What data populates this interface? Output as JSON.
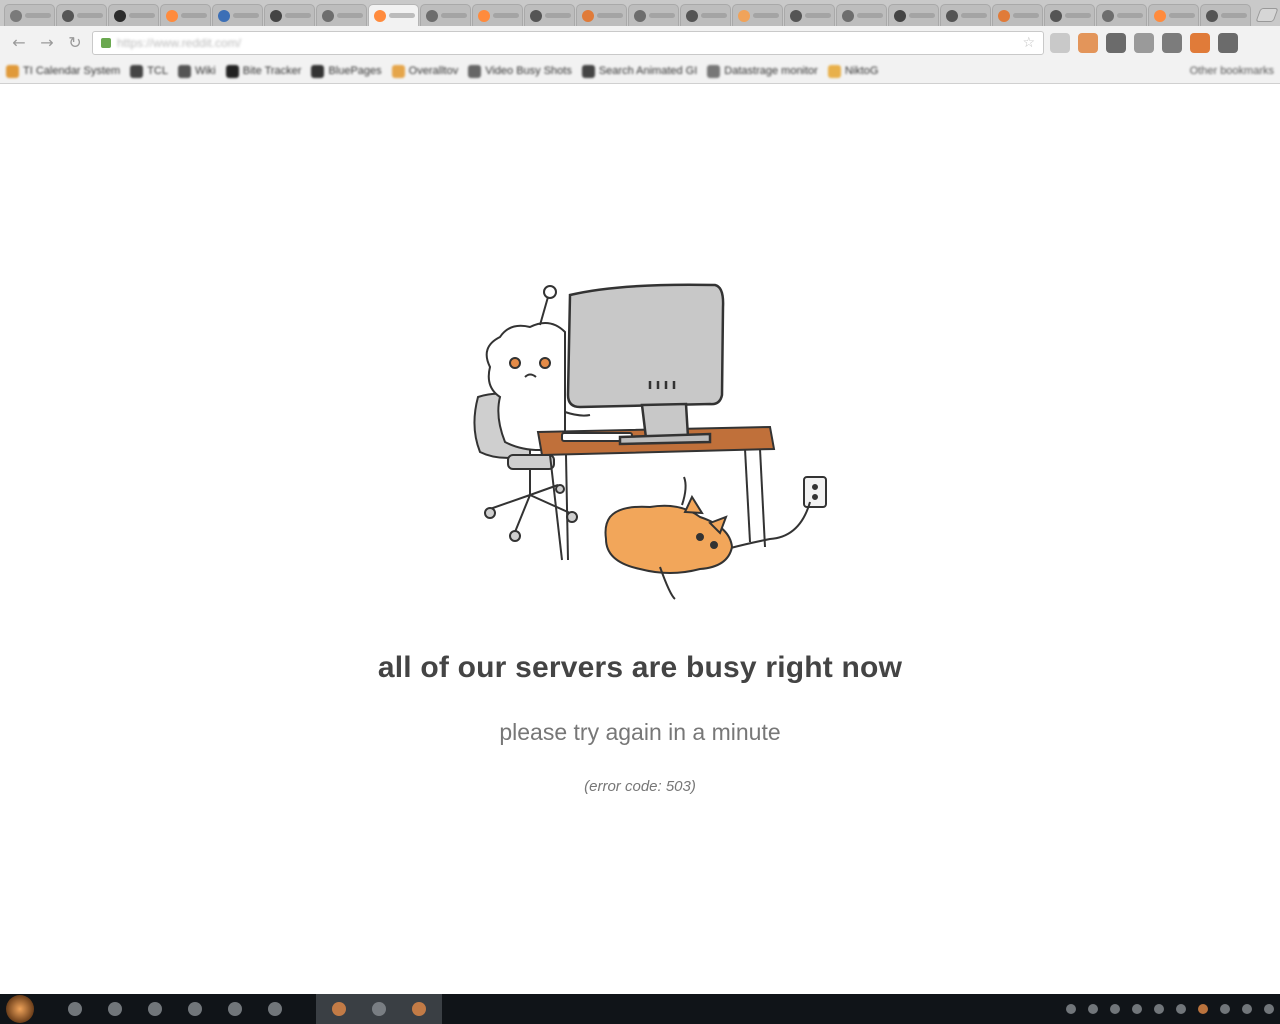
{
  "browser": {
    "tab_favicon_colors": [
      "#7a7a7a",
      "#555555",
      "#2b2b2b",
      "#ff8b3d",
      "#3c6fb6",
      "#444444",
      "#6d6d6d",
      "#ff8b3d",
      "#6d6d6d",
      "#ff8b3d",
      "#555555",
      "#e07b39",
      "#6d6d6d",
      "#555555",
      "#f0a35a",
      "#555555",
      "#6d6d6d",
      "#444444",
      "#555555",
      "#e07b39",
      "#555555",
      "#6d6d6d",
      "#ff8b3d",
      "#555555"
    ],
    "active_tab_index": 7,
    "url": "https://www.reddit.com/",
    "extension_colors": [
      "#c9c9c9",
      "#e3955a",
      "#6b6b6b",
      "#9a9a9a",
      "#7c7c7c",
      "#e07b39",
      "#6b6b6b"
    ]
  },
  "bookmarks": {
    "items": [
      {
        "label": "TI Calendar System",
        "color": "#e09a3a"
      },
      {
        "label": "TCL",
        "color": "#444444"
      },
      {
        "label": "Wiki",
        "color": "#555555"
      },
      {
        "label": "Bite Tracker",
        "color": "#222222"
      },
      {
        "label": "BluePages",
        "color": "#333333"
      },
      {
        "label": "Overalltov",
        "color": "#e5a54a"
      },
      {
        "label": "Video Busy Shots",
        "color": "#666666"
      },
      {
        "label": "Search Animated GI",
        "color": "#444444"
      },
      {
        "label": "Datastrage monitor",
        "color": "#777777"
      },
      {
        "label": "NiktoG",
        "color": "#e8b04a"
      }
    ],
    "other_label": "Other bookmarks"
  },
  "error_page": {
    "headline": "all of our servers are busy right now",
    "subline": "please try again in a minute",
    "error_code": "(error code: 503)"
  }
}
